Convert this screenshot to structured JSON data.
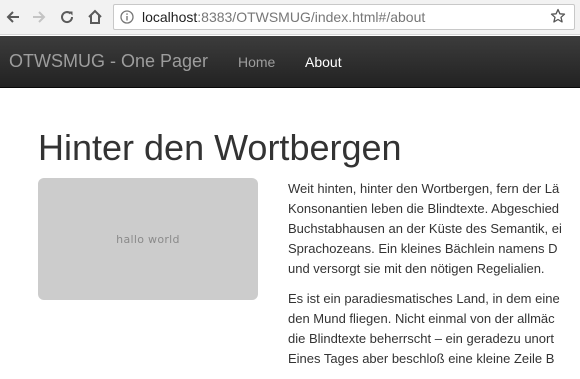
{
  "browser": {
    "url_host": "localhost",
    "url_rest": ":8383/OTWSMUG/index.html#/about"
  },
  "navbar": {
    "brand": "OTWSMUG - One Pager",
    "links": [
      {
        "label": "Home"
      },
      {
        "label": "About"
      }
    ]
  },
  "main": {
    "title": "Hinter den Wortbergen",
    "image_text": "hallo world",
    "paragraph1_lines": [
      "Weit hinten, hinter den Wortbergen, fern der Lä",
      "Konsonantien leben die Blindtexte. Abgeschied",
      "Buchstabhausen an der Küste des Semantik, ei",
      "Sprachozeans. Ein kleines Bächlein namens D",
      "und versorgt sie mit den nötigen Regelialien."
    ],
    "paragraph2_lines": [
      "Es ist ein paradiesmatisches Land, in dem eine",
      "den Mund fliegen. Nicht einmal von der allmäc",
      "die Blindtexte beherrscht – ein geradezu unort",
      "Eines Tages aber beschloß eine kleine Zeile B"
    ]
  }
}
